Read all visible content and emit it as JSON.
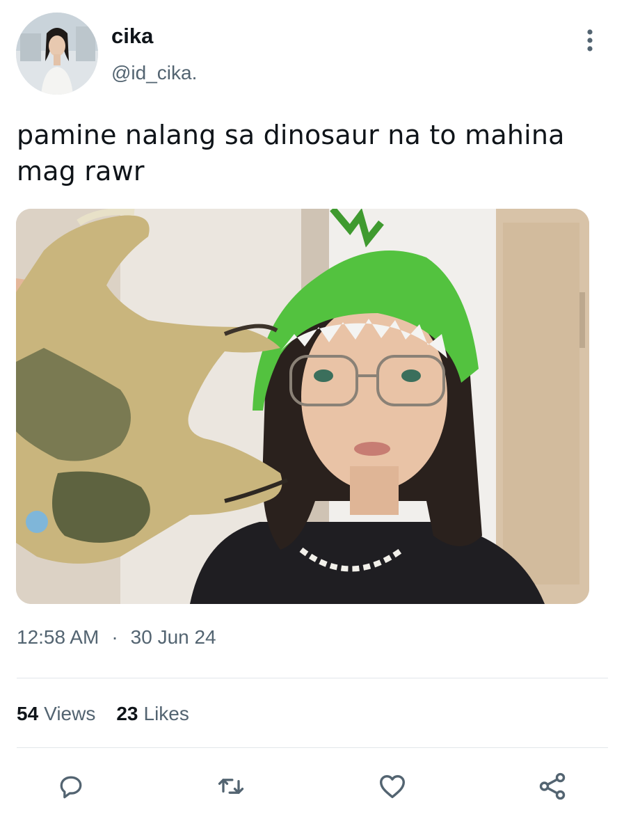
{
  "author": {
    "display_name": "cika",
    "handle": "@id_cika.",
    "avatar": "profile-photo"
  },
  "tweet": {
    "text": "pamine nalang sa dinosaur na to mahina mag rawr",
    "media": "photo-girl-with-dinosaur-hat-and-toy"
  },
  "meta": {
    "time": "12:58 AM",
    "separator": "·",
    "date": "30 Jun 24"
  },
  "stats": {
    "views_count": "54",
    "views_label": "Views",
    "likes_count": "23",
    "likes_label": "Likes"
  },
  "actions": {
    "reply_icon": "reply-icon",
    "retweet_icon": "retweet-icon",
    "like_icon": "heart-icon",
    "share_icon": "share-icon"
  },
  "colors": {
    "text_primary": "#0f1419",
    "text_secondary": "#536471",
    "divider": "#e1e6ea",
    "icon": "#536471"
  }
}
